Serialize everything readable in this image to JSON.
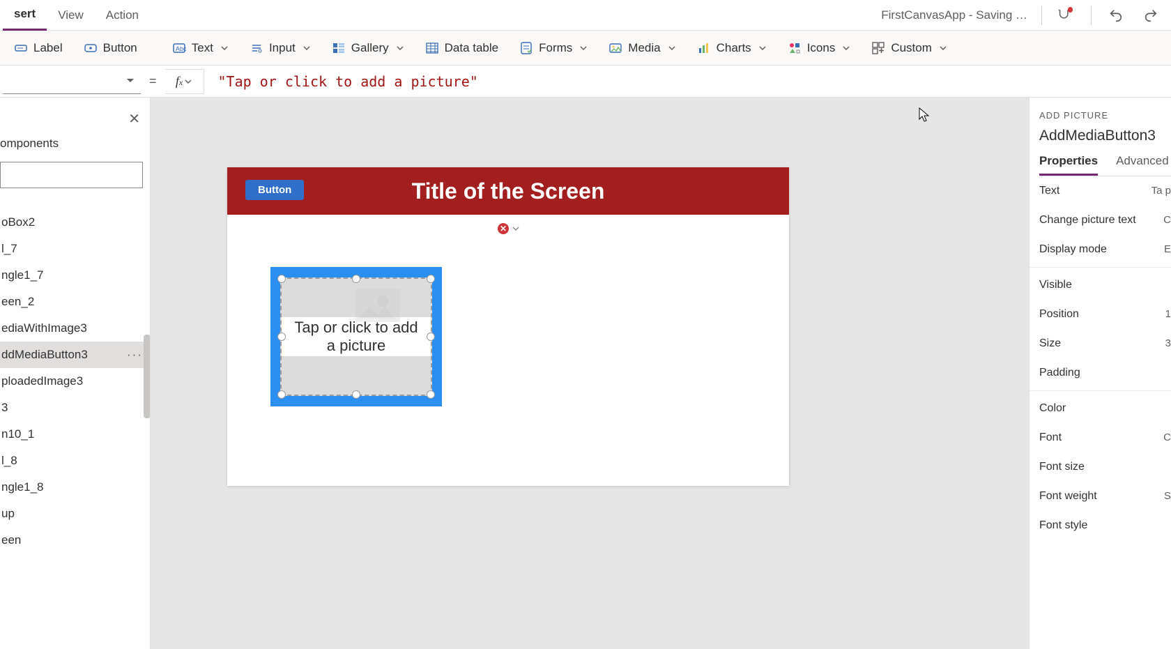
{
  "header": {
    "tabs": [
      "sert",
      "View",
      "Action"
    ],
    "active_tab_index": 0,
    "file_status": "FirstCanvasApp - Saving …"
  },
  "ribbon": {
    "items": [
      {
        "label": "Label",
        "icon": "label-icon",
        "has_dropdown": false
      },
      {
        "label": "Button",
        "icon": "button-icon",
        "has_dropdown": false
      },
      {
        "label": "Text",
        "icon": "text-icon",
        "has_dropdown": true
      },
      {
        "label": "Input",
        "icon": "input-icon",
        "has_dropdown": true
      },
      {
        "label": "Gallery",
        "icon": "gallery-icon",
        "has_dropdown": true
      },
      {
        "label": "Data table",
        "icon": "datatable-icon",
        "has_dropdown": false
      },
      {
        "label": "Forms",
        "icon": "forms-icon",
        "has_dropdown": true
      },
      {
        "label": "Media",
        "icon": "media-icon",
        "has_dropdown": true
      },
      {
        "label": "Charts",
        "icon": "charts-icon",
        "has_dropdown": true
      },
      {
        "label": "Icons",
        "icon": "icons-icon",
        "has_dropdown": true
      },
      {
        "label": "Custom",
        "icon": "custom-icon",
        "has_dropdown": true
      }
    ]
  },
  "formula_bar": {
    "property_selected": "",
    "value": "\"Tap or click to add a picture\""
  },
  "tree": {
    "heading": "omponents",
    "items": [
      "oBox2",
      "l_7",
      "ngle1_7",
      "een_2",
      "ediaWithImage3",
      "ddMediaButton3",
      "ploadedImage3",
      "3",
      "n10_1",
      "l_8",
      "ngle1_8",
      "up",
      "een"
    ],
    "selected_index": 5
  },
  "canvas": {
    "screen_title": "Title of the Screen",
    "button_label": "Button",
    "media_placeholder": "Tap or click to add a picture"
  },
  "properties": {
    "category": "ADD PICTURE",
    "control_name": "AddMediaButton3",
    "tabs": [
      "Properties",
      "Advanced"
    ],
    "active_tab_index": 0,
    "rows": [
      {
        "label": "Text",
        "value": "Ta\np"
      },
      {
        "label": "Change picture text",
        "value": "C"
      },
      {
        "label": "Display mode",
        "value": "E"
      },
      {
        "label": "Visible",
        "value": ""
      },
      {
        "label": "Position",
        "value": "1"
      },
      {
        "label": "Size",
        "value": "3"
      },
      {
        "label": "Padding",
        "value": ""
      },
      {
        "label": "Color",
        "value": ""
      },
      {
        "label": "Font",
        "value": "C"
      },
      {
        "label": "Font size",
        "value": ""
      },
      {
        "label": "Font weight",
        "value": "S"
      },
      {
        "label": "Font style",
        "value": ""
      }
    ]
  }
}
